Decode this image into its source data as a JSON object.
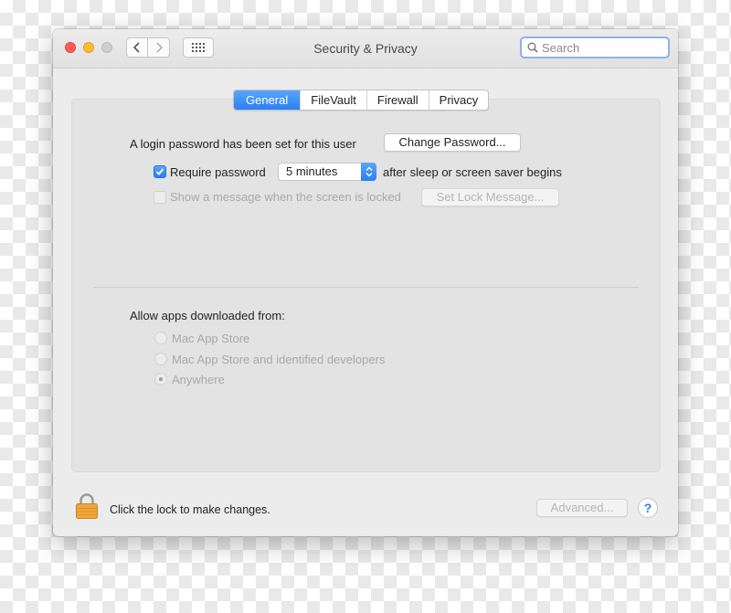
{
  "window": {
    "title": "Security & Privacy"
  },
  "search": {
    "placeholder": "Search"
  },
  "tabs": [
    {
      "label": "General",
      "active": true
    },
    {
      "label": "FileVault",
      "active": false
    },
    {
      "label": "Firewall",
      "active": false
    },
    {
      "label": "Privacy",
      "active": false
    }
  ],
  "general": {
    "login_text": "A login password has been set for this user",
    "change_password_label": "Change Password...",
    "require_password": {
      "label": "Require password",
      "checked": true,
      "delay": "5 minutes",
      "suffix": "after sleep or screen saver begins"
    },
    "show_message": {
      "label": "Show a message when the screen is locked",
      "checked": false,
      "enabled": false,
      "button_label": "Set Lock Message..."
    }
  },
  "allow_apps": {
    "heading": "Allow apps downloaded from:",
    "options": [
      {
        "label": "Mac App Store",
        "selected": false
      },
      {
        "label": "Mac App Store and identified developers",
        "selected": false
      },
      {
        "label": "Anywhere",
        "selected": true
      }
    ]
  },
  "footer": {
    "lock_text": "Click the lock to make changes.",
    "advanced_label": "Advanced...",
    "help_label": "?"
  },
  "colors": {
    "accent": "#2a7ff4",
    "lock": "#f0a63a"
  }
}
